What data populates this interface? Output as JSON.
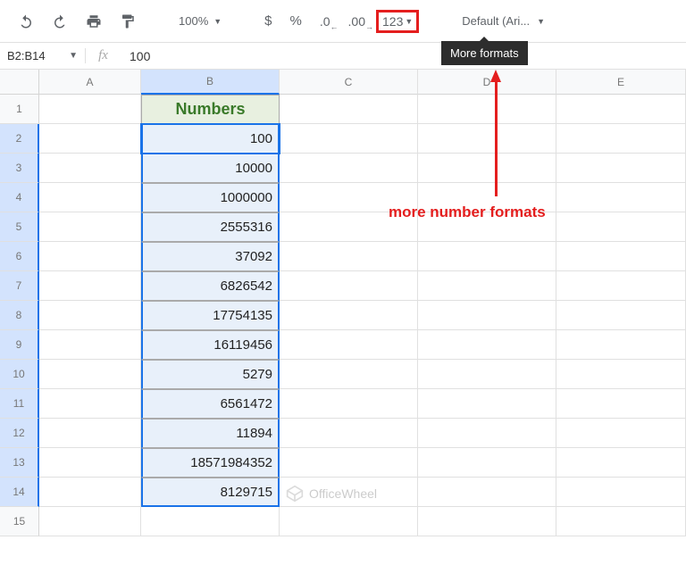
{
  "toolbar": {
    "zoom": "100%",
    "currency_symbol": "$",
    "percent_symbol": "%",
    "dec_decrease": ".0",
    "dec_increase": ".00",
    "more_formats_label": "123",
    "font_label": "Default (Ari..."
  },
  "tooltip": {
    "more_formats": "More formats"
  },
  "namebox": {
    "range": "B2:B14",
    "fx": "fx",
    "formula_value": "100"
  },
  "columns": [
    "A",
    "B",
    "C",
    "D",
    "E"
  ],
  "row_numbers": [
    "1",
    "2",
    "3",
    "4",
    "5",
    "6",
    "7",
    "8",
    "9",
    "10",
    "11",
    "12",
    "13",
    "14",
    "15"
  ],
  "table": {
    "header": "Numbers",
    "values": [
      "100",
      "10000",
      "1000000",
      "2555316",
      "37092",
      "6826542",
      "17754135",
      "16119456",
      "5279",
      "6561472",
      "11894",
      "18571984352",
      "8129715"
    ]
  },
  "annotation": {
    "label": "more number formats"
  },
  "watermark": {
    "text": "OfficeWheel"
  }
}
